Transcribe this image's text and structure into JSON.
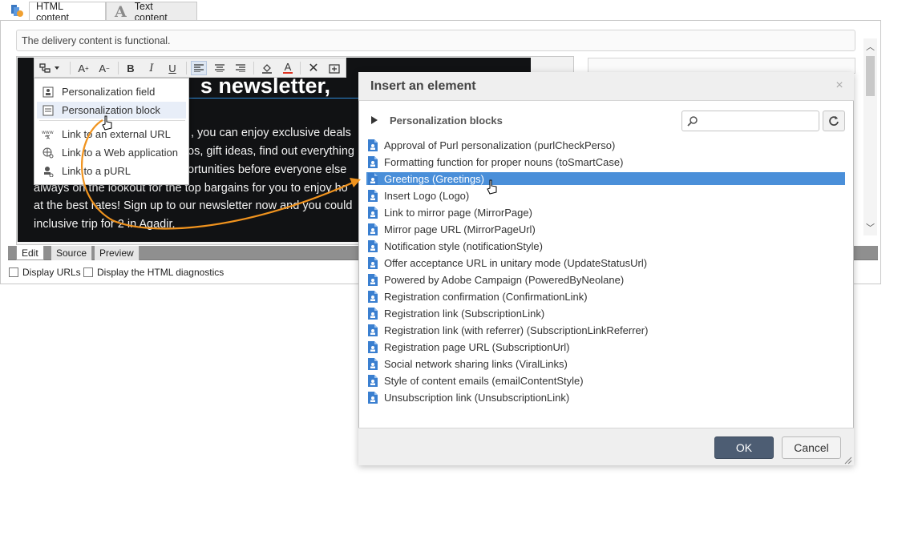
{
  "tabs": [
    {
      "label": "HTML content",
      "active": true
    },
    {
      "label": "Text content",
      "active": false
    }
  ],
  "status_message": "The delivery content is functional.",
  "content_preview": {
    "heading": "s newsletter,",
    "lines": [
      ", you can enjoy exclusive deals",
      "os, gift ideas, find out everything",
      "ortunities before everyone else",
      "always on the lookout for the top bargains for you to enjoy ho",
      "at the best rates! Sign up to our newsletter now and you could",
      "inclusive trip for 2 in Agadir."
    ]
  },
  "editor_tabs": [
    "Edit",
    "Source",
    "Preview"
  ],
  "checkboxes": [
    {
      "label": "Display URLs",
      "checked": false
    },
    {
      "label": "Display the HTML diagnostics",
      "checked": false
    }
  ],
  "menu": {
    "items": [
      {
        "label": "Personalization field",
        "icon": "personalization-field-icon"
      },
      {
        "label": "Personalization block",
        "icon": "personalization-block-icon"
      },
      {
        "label": "Link to an external URL",
        "icon": "external-url-icon"
      },
      {
        "label": "Link to a Web application",
        "icon": "web-application-icon"
      },
      {
        "label": "Link to a pURL",
        "icon": "purl-icon"
      }
    ]
  },
  "dialog": {
    "title": "Insert an element",
    "section": "Personalization blocks",
    "items": [
      "Approval of Purl personalization (purlCheckPerso)",
      "Formatting function for proper nouns (toSmartCase)",
      "Greetings (Greetings)",
      "Insert Logo (Logo)",
      "Link to mirror page (MirrorPage)",
      "Mirror page URL (MirrorPageUrl)",
      "Notification style (notificationStyle)",
      "Offer acceptance URL in unitary mode (UpdateStatusUrl)",
      "Powered by Adobe Campaign (PoweredByNeolane)",
      "Registration confirmation (ConfirmationLink)",
      "Registration link (SubscriptionLink)",
      "Registration link (with referrer) (SubscriptionLinkReferrer)",
      "Registration page URL (SubscriptionUrl)",
      "Social network sharing links (ViralLinks)",
      "Style of content emails (emailContentStyle)",
      "Unsubscription link (UnsubscriptionLink)"
    ],
    "selected_index": 2,
    "ok_label": "OK",
    "cancel_label": "Cancel"
  },
  "colors": {
    "accent": "#4a8fd9",
    "annotation_arrow": "#f0931e",
    "ok_button": "#4d5d73"
  }
}
